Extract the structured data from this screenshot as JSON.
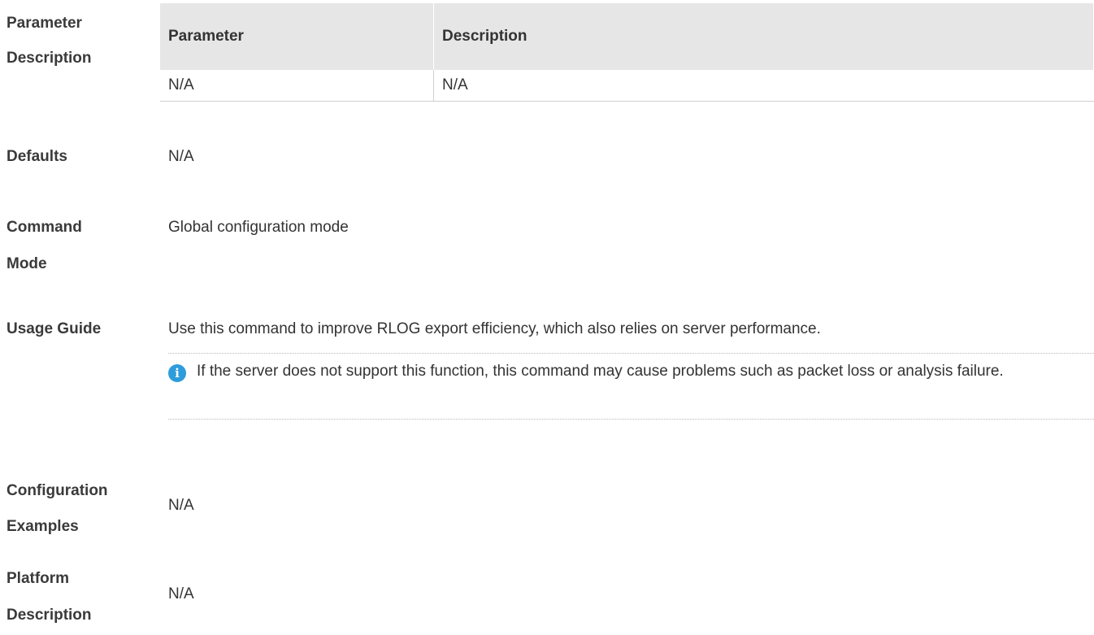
{
  "sections": {
    "parameter_description": {
      "label_line1": "Parameter",
      "label_line2": "Description",
      "table": {
        "headers": [
          "Parameter",
          "Description"
        ],
        "rows": [
          [
            "N/A",
            "N/A"
          ]
        ]
      }
    },
    "defaults": {
      "label": "Defaults",
      "value": "N/A"
    },
    "command_mode": {
      "label_line1": "Command",
      "label_line2": "Mode",
      "value": "Global configuration mode"
    },
    "usage_guide": {
      "label": "Usage Guide",
      "value": "Use this command to improve RLOG export efficiency, which also relies on server performance.",
      "note": {
        "icon": "info-icon",
        "icon_glyph": "i",
        "text": "If the server does not support this function, this command may cause problems such as packet loss or analysis failure."
      }
    },
    "configuration_examples": {
      "label_line1": "Configuration",
      "label_line2": "Examples",
      "value": "N/A"
    },
    "platform_description": {
      "label_line1": "Platform",
      "label_line2": "Description",
      "value": "N/A"
    }
  },
  "colors": {
    "header_bg": "#e6e6e6",
    "info_icon": "#2d9cdb",
    "text": "#333333"
  }
}
